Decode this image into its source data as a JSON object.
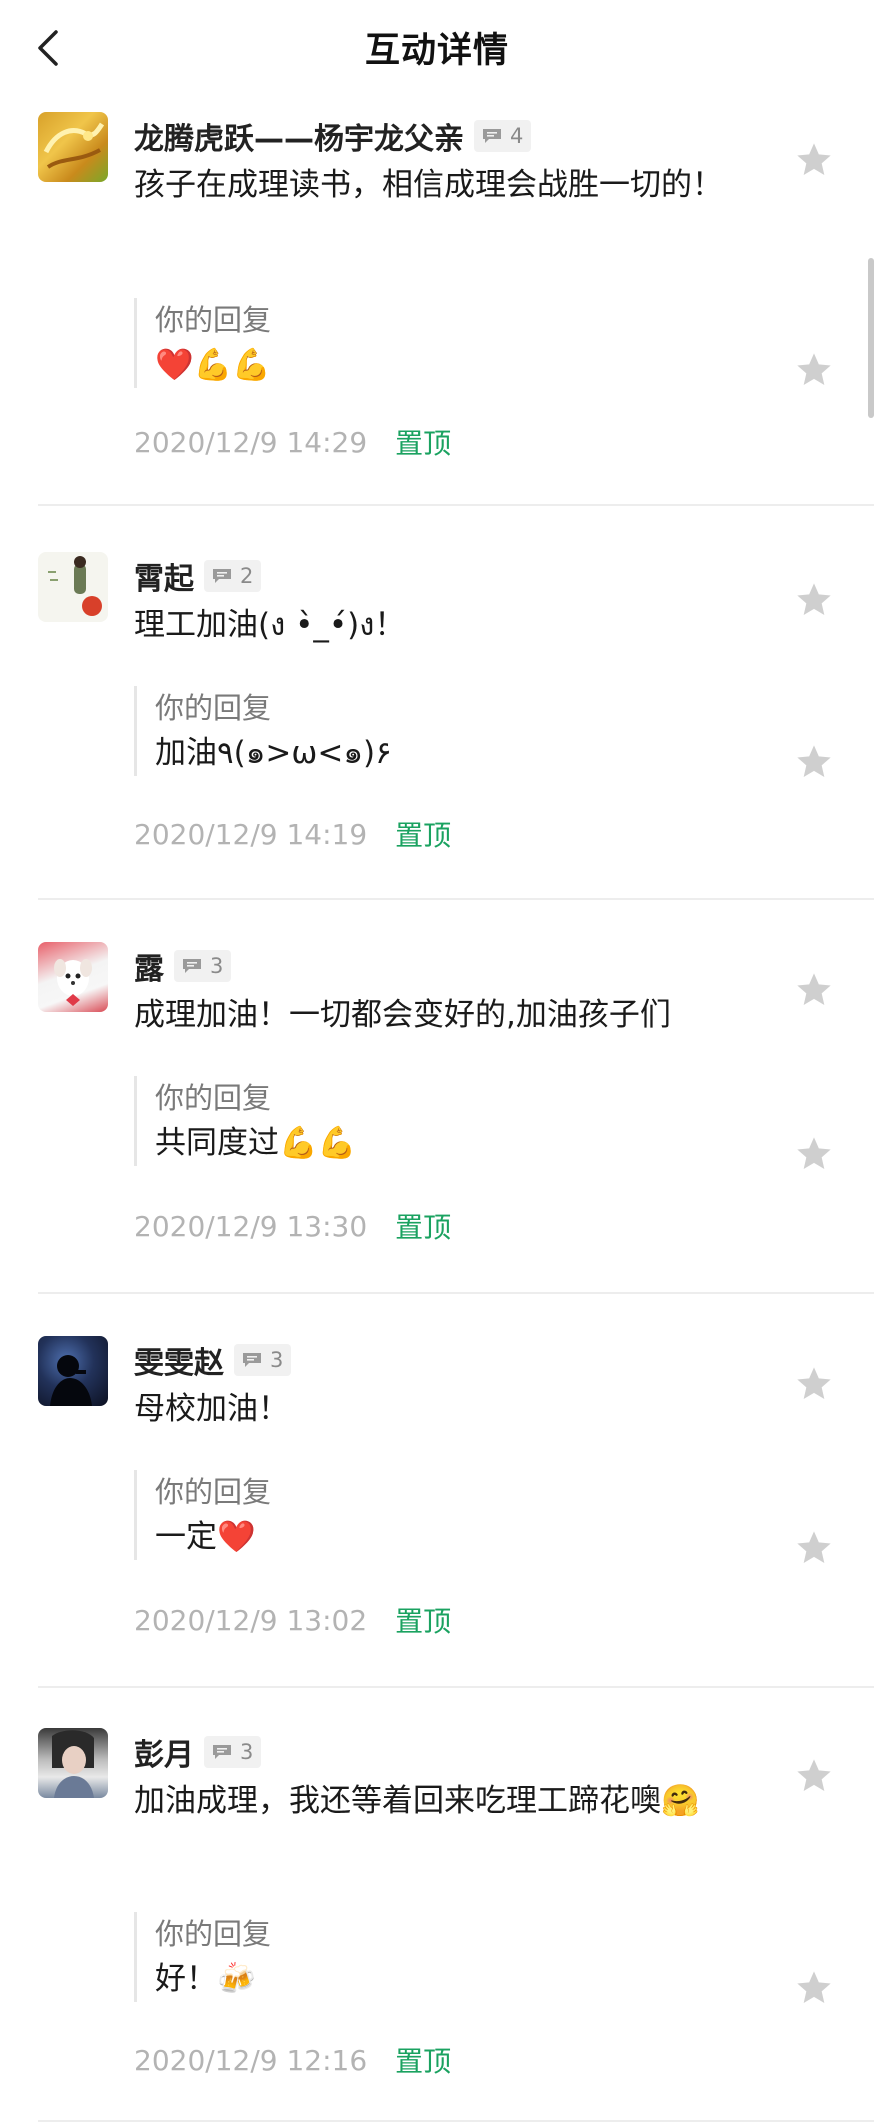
{
  "header": {
    "title": "互动详情"
  },
  "colors": {
    "accent_green": "#1aa260",
    "star_gray": "#cfcfcf",
    "timestamp_gray": "#b3b3b3"
  },
  "comments": [
    {
      "user_name": "龙腾虎跃——杨宇龙父亲",
      "reply_count": "4",
      "message": "孩子在成理读书，相信成理会战胜一切的！",
      "reply_label": "你的回复",
      "reply": "❤️💪💪",
      "timestamp": "2020/12/9 14:29",
      "pin_label": "置顶"
    },
    {
      "user_name": "霄起",
      "reply_count": "2",
      "message": "理工加油(ง •̀_•́)ง！",
      "reply_label": "你的回复",
      "reply": "加油٩(๑>ω<๑)۶",
      "timestamp": "2020/12/9 14:19",
      "pin_label": "置顶"
    },
    {
      "user_name": "露",
      "reply_count": "3",
      "message": "成理加油！一切都会变好的,加油孩子们",
      "reply_label": "你的回复",
      "reply": "共同度过💪💪",
      "timestamp": "2020/12/9 13:30",
      "pin_label": "置顶"
    },
    {
      "user_name": "雯雯赵",
      "reply_count": "3",
      "message": "母校加油！",
      "reply_label": "你的回复",
      "reply": "一定❤️",
      "timestamp": "2020/12/9 13:02",
      "pin_label": "置顶"
    },
    {
      "user_name": "彭月",
      "reply_count": "3",
      "message": "加油成理，我还等着回来吃理工蹄花噢🤗",
      "reply_label": "你的回复",
      "reply": "好！🍻",
      "timestamp": "2020/12/9 12:16",
      "pin_label": "置顶"
    }
  ]
}
